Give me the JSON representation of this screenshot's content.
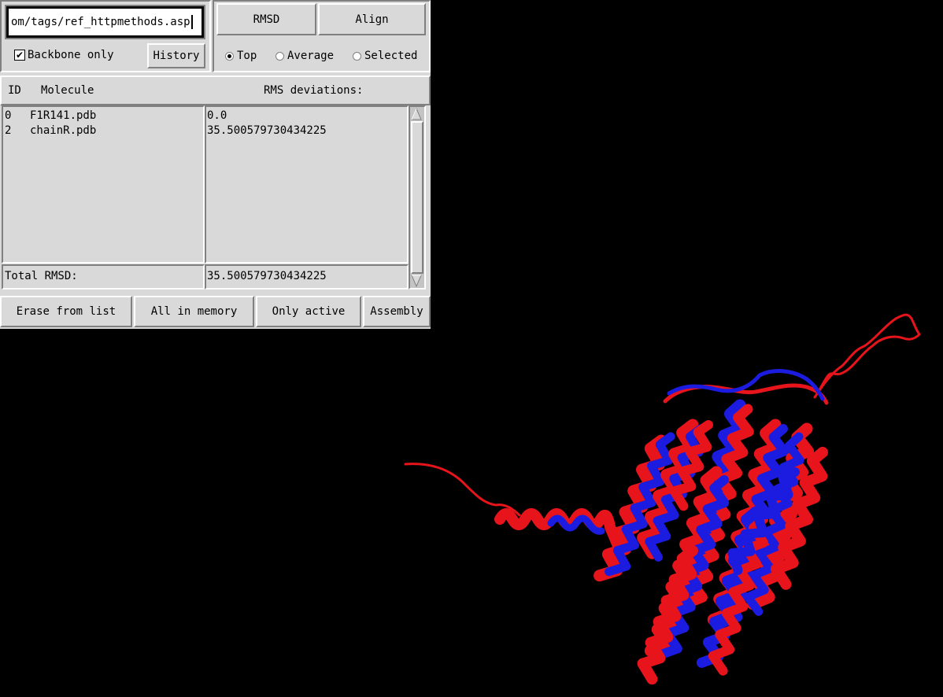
{
  "entry": {
    "value": "om/tags/ref_httpmethods.asp"
  },
  "options": {
    "backbone_label": "Backbone only",
    "backbone_checked": true,
    "history_label": "History"
  },
  "actions": {
    "rmsd_label": "RMSD",
    "align_label": "Align"
  },
  "reference": {
    "options": [
      "Top",
      "Average",
      "Selected"
    ],
    "selected": "Top"
  },
  "table": {
    "headers": {
      "id": "ID",
      "molecule": "Molecule",
      "rms": "RMS deviations:"
    },
    "rows": [
      {
        "id": "0",
        "molecule": "F1R141.pdb",
        "rms": "0.0"
      },
      {
        "id": "2",
        "molecule": "chainR.pdb",
        "rms": "35.500579730434225"
      }
    ],
    "total_label": "Total RMSD:",
    "total_value": "35.500579730434225"
  },
  "bottom_buttons": {
    "erase": "Erase from list",
    "all": "All in memory",
    "active": "Only active",
    "assembly": "Assembly"
  },
  "scene": {
    "background": "#000000",
    "structure_colors": [
      "#e8141c",
      "#1c1ce0"
    ]
  }
}
